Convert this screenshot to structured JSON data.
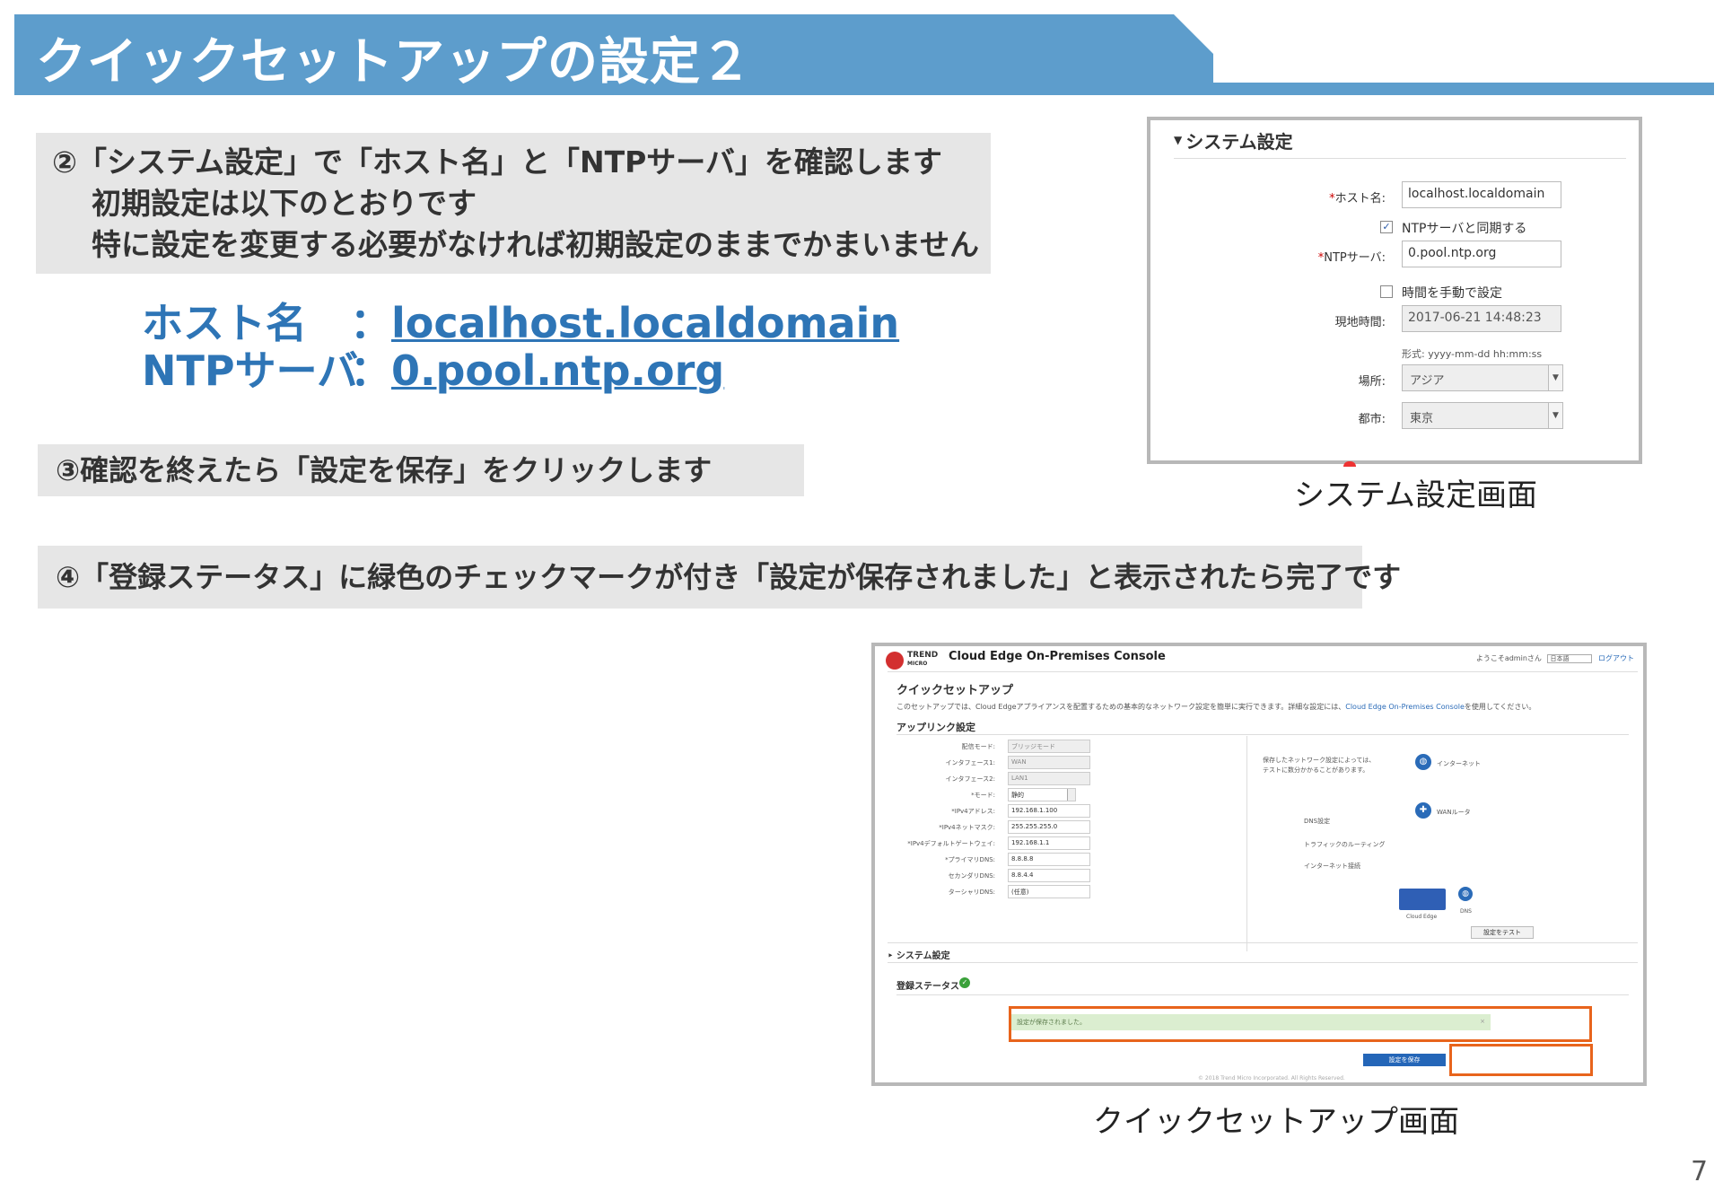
{
  "slide": {
    "title": "クイックセットアップの設定２",
    "page_number": "7"
  },
  "step2": {
    "line1": "②「システム設定」で「ホスト名」と「NTPサーバ」を確認します",
    "line2": "初期設定は以下のとおりです",
    "line3": "特に設定を変更する必要がなければ初期設定のままでかまいません"
  },
  "defaults": {
    "host_label": "ホスト名",
    "host_value": "localhost.localdomain",
    "ntp_label": "NTPサーバ",
    "ntp_value": "0.pool.ntp.org",
    "colon": "："
  },
  "step3": {
    "text": "③確認を終えたら「設定を保存」をクリックします"
  },
  "step4": {
    "text": "④「登録ステータス」に緑色のチェックマークが付き「設定が保存されました」と表示されたら完了です"
  },
  "system_screen": {
    "caption": "システム設定画面",
    "header": "システム設定",
    "host_label": "ホスト名:",
    "host_value": "localhost.localdomain",
    "ntp_sync_label": "NTPサーバと同期する",
    "ntp_sync_checked": true,
    "ntp_label": "NTPサーバ:",
    "ntp_value": "0.pool.ntp.org",
    "manual_time_label": "時間を手動で設定",
    "manual_time_checked": false,
    "current_time_label": "現地時間:",
    "current_time_value": "2017-06-21 14:48:23",
    "format_hint": "形式: yyyy-mm-dd hh:mm:ss",
    "place_label": "場所:",
    "place_value": "アジア",
    "city_label": "都市:",
    "city_value": "東京"
  },
  "quick_screen": {
    "caption": "クイックセットアップ画面",
    "brand_top": "TREND",
    "brand_bottom": "MICRO",
    "console_title": "Cloud Edge On-Premises Console",
    "welcome": "ようこそadminさん",
    "language": "日本語",
    "logout": "ログアウト",
    "heading": "クイックセットアップ",
    "description": "このセットアップでは、Cloud Edgeアプライアンスを配置するための基本的なネットワーク設定を簡単に実行できます。詳細な設定には、",
    "description_link": "Cloud Edge On-Premises Console",
    "description_end": "を使用してください。",
    "uplink_heading": "アップリンク設定",
    "fields": [
      {
        "label": "配信モード:",
        "value": "ブリッジモード",
        "readonly": true
      },
      {
        "label": "インタフェース1:",
        "value": "WAN",
        "readonly": true
      },
      {
        "label": "インタフェース2:",
        "value": "LAN1",
        "readonly": true
      },
      {
        "label": "*モード:",
        "value": "静的",
        "readonly": false
      },
      {
        "label": "*IPv4アドレス:",
        "value": "192.168.1.100",
        "readonly": false
      },
      {
        "label": "*IPv4ネットマスク:",
        "value": "255.255.255.0",
        "readonly": false
      },
      {
        "label": "*IPv4デフォルトゲートウェイ:",
        "value": "192.168.1.1",
        "readonly": false
      },
      {
        "label": "*プライマリDNS:",
        "value": "8.8.8.8",
        "readonly": false
      },
      {
        "label": "セカンダリDNS:",
        "value": "8.8.4.4",
        "readonly": false
      },
      {
        "label": "ターシャリDNS:",
        "value": "(任意)",
        "readonly": false
      }
    ],
    "right_note_1": "保存したネットワーク設定によっては、",
    "right_note_2": "テストに数分かかることがあります。",
    "internet_label": "インターネット",
    "router_label": "WANルータ",
    "dns_setting": "DNS設定",
    "traffic_routing": "トラフィックのルーティング",
    "internet_connection": "インターネット接続",
    "device_label": "Cloud Edge",
    "dns_label": "DNS",
    "test_button": "設定をテスト",
    "system_settings": "システム設定",
    "registration_status": "登録ステータス",
    "saved_message": "設定が保存されました。",
    "save_button": "設定を保存",
    "copyright": "© 2018 Trend Micro Incorporated. All Rights Reserved."
  },
  "colors": {
    "banner": "#5d9dcc",
    "link_blue": "#2e75b6",
    "highlight_orange": "#e8641c",
    "step_box": "#e6e6e6"
  }
}
